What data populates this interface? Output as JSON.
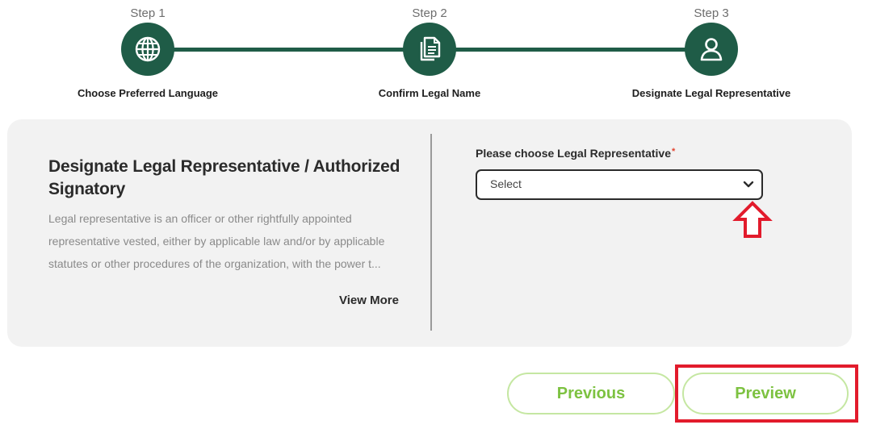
{
  "stepper": {
    "steps": [
      {
        "number": "Step 1",
        "label": "Choose Preferred Language",
        "icon": "globe-icon"
      },
      {
        "number": "Step 2",
        "label": "Confirm Legal Name",
        "icon": "document-icon"
      },
      {
        "number": "Step 3",
        "label": "Designate Legal Representative",
        "icon": "person-icon"
      }
    ]
  },
  "panel": {
    "title": "Designate Legal Representative / Authorized Signatory",
    "description": "Legal representative is an officer or other rightfully appointed representative vested, either by applicable law and/or by applicable statutes or other procedures of the organization, with the power t...",
    "view_more": "View More"
  },
  "form": {
    "label": "Please choose Legal Representative",
    "required_marker": "*",
    "select_value": "Select"
  },
  "buttons": {
    "previous": "Previous",
    "preview": "Preview"
  },
  "colors": {
    "step_green": "#1f5c47",
    "button_text": "#7dc241",
    "button_border": "#c5e7a2",
    "annotation_red": "#e21b2c"
  }
}
